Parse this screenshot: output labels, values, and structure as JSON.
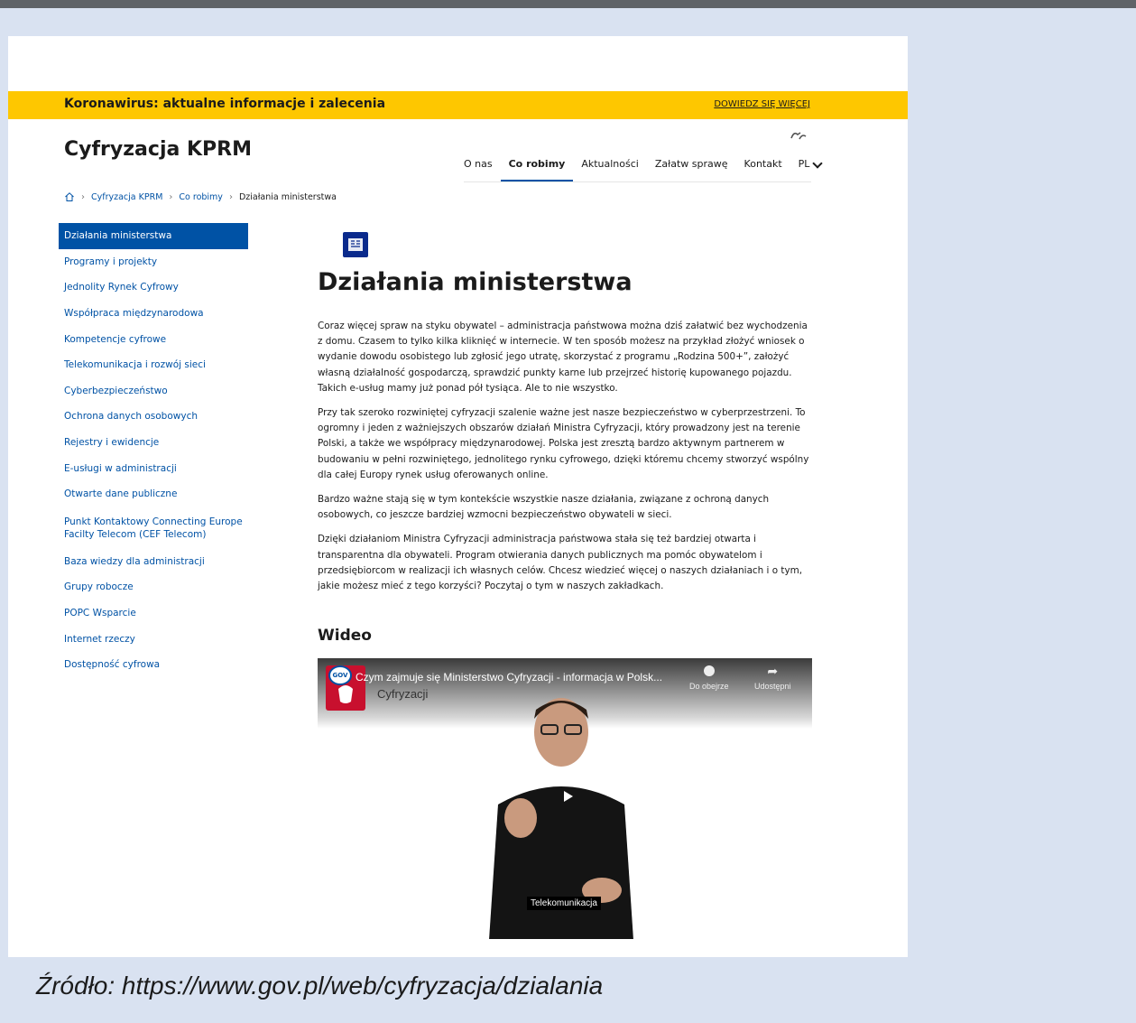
{
  "covid_banner": {
    "title": "Koronawirus: aktualne informacje i zalecenia",
    "link": "DOWIEDZ SIĘ WIĘCEJ"
  },
  "site": {
    "title": "Cyfryzacja KPRM"
  },
  "nav": {
    "items": [
      "O nas",
      "Co robimy",
      "Aktualności",
      "Załatw sprawę",
      "Kontakt"
    ],
    "active": "Co robimy",
    "language": "PL"
  },
  "breadcrumb": [
    "Cyfryzacja KPRM",
    "Co robimy",
    "Działania ministerstwa"
  ],
  "sidebar": {
    "items": [
      "Działania ministerstwa",
      "Programy i projekty",
      "Jednolity Rynek Cyfrowy",
      "Współpraca międzynarodowa",
      "Kompetencje cyfrowe",
      "Telekomunikacja i rozwój sieci",
      "Cyberbezpieczeństwo",
      "Ochrona danych osobowych",
      "Rejestry i ewidencje",
      "E-usługi w administracji",
      "Otwarte dane publiczne",
      "Punkt Kontaktowy Connecting Europe Facilty Telecom (CEF Telecom)",
      "Baza wiedzy dla administracji",
      "Grupy robocze",
      "POPC Wsparcie",
      "Internet rzeczy",
      "Dostępność cyfrowa"
    ],
    "active_index": 0
  },
  "main": {
    "title": "Działania ministerstwa",
    "paragraphs": [
      "Coraz więcej spraw na styku obywatel – administracja państwowa można dziś załatwić bez wychodzenia z domu. Czasem to tylko kilka kliknięć w internecie. W ten sposób możesz na przykład złożyć wniosek o wydanie dowodu osobistego lub zgłosić jego utratę, skorzystać z programu „Rodzina 500+”, założyć własną działalność gospodarczą, sprawdzić punkty karne lub przejrzeć historię kupowanego pojazdu. Takich e-usług mamy już ponad pół tysiąca. Ale to nie wszystko.",
      "Przy tak szeroko rozwiniętej cyfryzacji szalenie ważne jest nasze bezpieczeństwo w cyberprzestrzeni. To ogromny i jeden z ważniejszych obszarów działań Ministra Cyfryzacji, który prowadzony jest na terenie Polski, a także we współpracy międzynarodowej. Polska jest zresztą bardzo aktywnym partnerem w budowaniu w pełni rozwiniętego, jednolitego rynku cyfrowego, dzięki któremu chcemy stworzyć wspólny dla całej Europy rynek usług oferowanych online.",
      "Bardzo ważne stają się w tym kontekście wszystkie nasze działania, związane z ochroną danych osobowych, co jeszcze bardziej wzmocni bezpieczeństwo obywateli w sieci.",
      "Dzięki działaniom Ministra Cyfryzacji administracja państwowa stała się też bardziej otwarta i transparentna dla obywateli. Program otwierania danych publicznych ma pomóc obywatelom i przedsiębiorcom w realizacji ich własnych celów. Chcesz wiedzieć więcej o naszych działaniach i o tym, jakie możesz mieć z tego korzyści? Poczytaj o tym w naszych zakładkach."
    ],
    "video_heading": "Wideo"
  },
  "video": {
    "title": "Czym zajmuje się Ministerstwo Cyfryzacji - informacja w Polsk...",
    "channel_text": "Cyfryzacji",
    "watch_later": "Do obejrze",
    "share": "Udostępni",
    "caption": "Telekomunikacja",
    "gov_badge": "GOV"
  },
  "source_caption": "Źródło: https://www.gov.pl/web/cyfryzacja/dzialania",
  "colors": {
    "accent": "#0052a5",
    "banner": "#fec700",
    "background": "#d9e2f1"
  }
}
